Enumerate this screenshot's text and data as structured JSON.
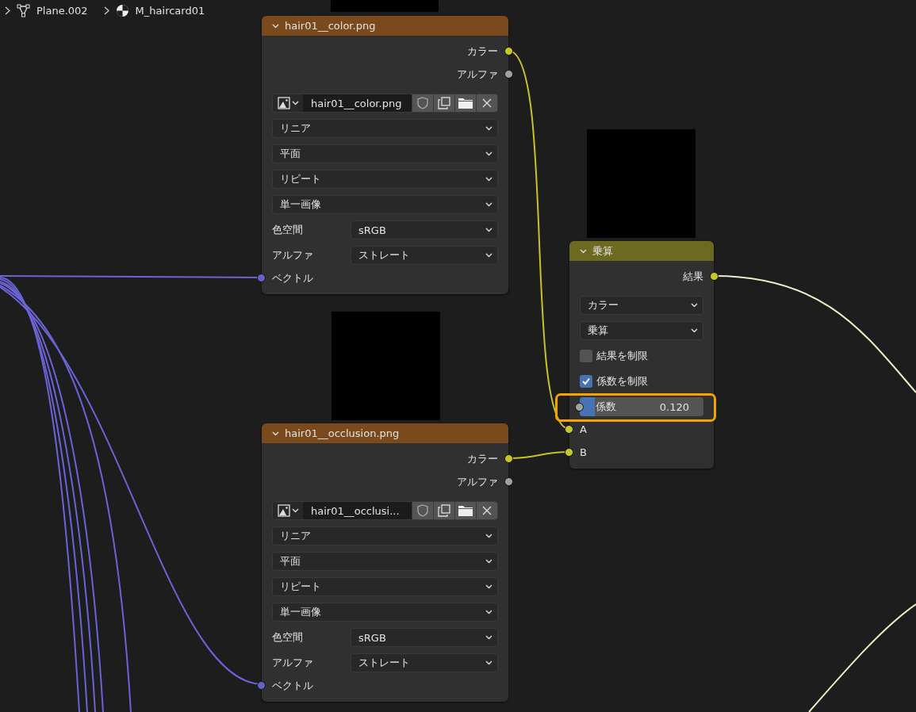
{
  "breadcrumb": [
    {
      "kind": "mesh",
      "label": "Plane.002"
    },
    {
      "kind": "material",
      "label": "M_haircard01"
    }
  ],
  "nodes": [
    {
      "kind": "image_texture",
      "title": "hair01__color.png",
      "outputs": [
        {
          "label": "カラー",
          "color": "#c7c729"
        },
        {
          "label": "アルファ",
          "color": "#a1a1a1"
        }
      ],
      "image": "hair01__color.png",
      "dropdowns": [
        "リニア",
        "平面",
        "リピート",
        "単一画像"
      ],
      "fields": [
        {
          "label": "色空間",
          "value": "sRGB"
        },
        {
          "label": "アルファ",
          "value": "ストレート"
        }
      ],
      "inputs": [
        {
          "label": "ベクトル",
          "color": "#6363c7"
        }
      ]
    },
    {
      "kind": "image_texture",
      "title": "hair01__occlusion.png",
      "outputs": [
        {
          "label": "カラー",
          "color": "#c7c729"
        },
        {
          "label": "アルファ",
          "color": "#a1a1a1"
        }
      ],
      "image": "hair01__occlusi...",
      "dropdowns": [
        "リニア",
        "平面",
        "リピート",
        "単一画像"
      ],
      "fields": [
        {
          "label": "色空間",
          "value": "sRGB"
        },
        {
          "label": "アルファ",
          "value": "ストレート"
        }
      ],
      "inputs": [
        {
          "label": "ベクトル",
          "color": "#6363c7"
        }
      ]
    },
    {
      "kind": "math",
      "title": "乗算",
      "outputs": [
        {
          "label": "結果",
          "color": "#c7c729"
        }
      ],
      "dropdowns": [
        "カラー",
        "乗算"
      ],
      "checkboxes": [
        {
          "label": "結果を制限",
          "checked": false
        },
        {
          "label": "係数を制限",
          "checked": true
        }
      ],
      "factor": {
        "label": "係数",
        "value": "0.120",
        "level": 0.12,
        "highlighted": true,
        "color": "#a1a1a1"
      },
      "inputs": [
        {
          "label": "A",
          "color": "#c7c729"
        },
        {
          "label": "B",
          "color": "#c7c729"
        }
      ]
    }
  ]
}
